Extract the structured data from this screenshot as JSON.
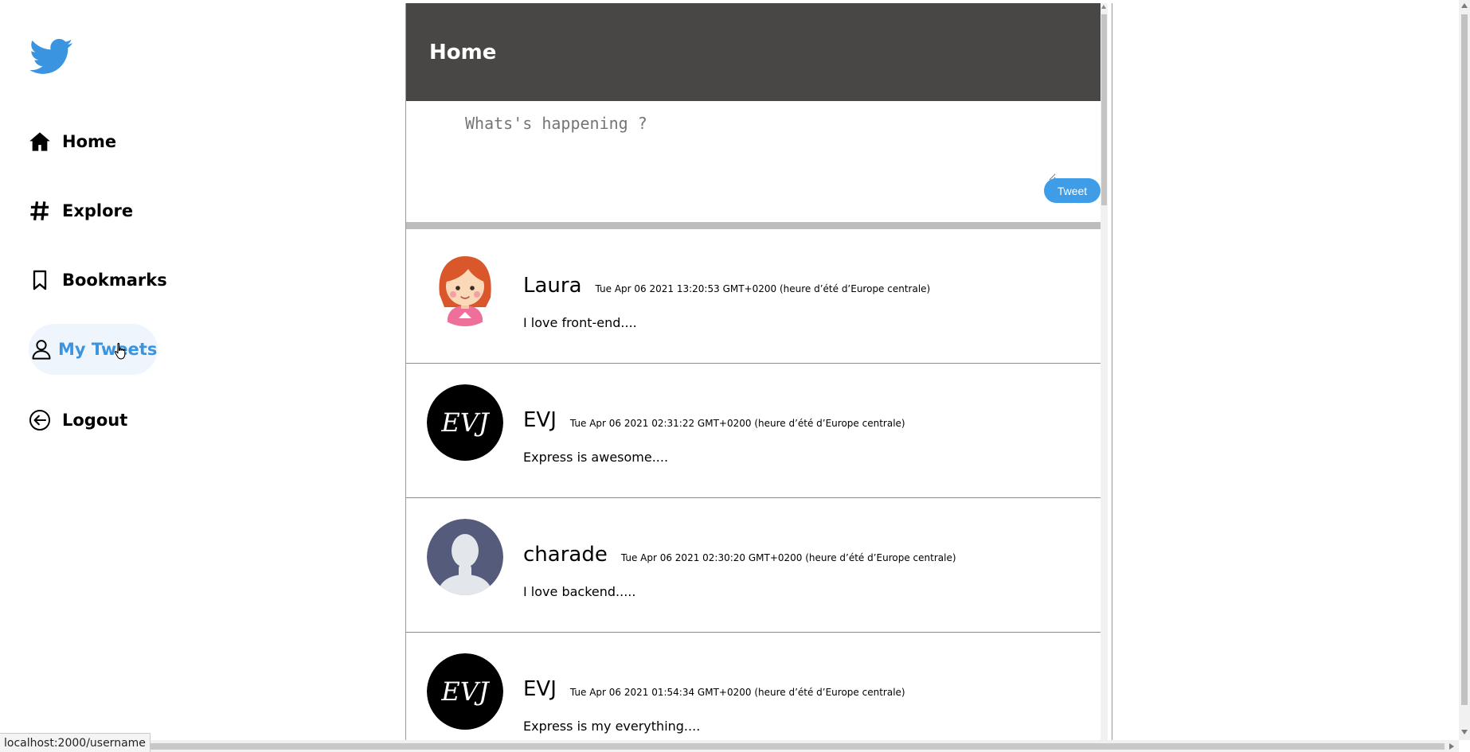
{
  "sidebar": {
    "logo": {
      "icon": "twitter-bird-icon",
      "color": "#3a94e0"
    },
    "items": [
      {
        "label": "Home",
        "icon": "home-icon"
      },
      {
        "label": "Explore",
        "icon": "hashtag-icon"
      },
      {
        "label": "Bookmarks",
        "icon": "bookmark-icon"
      },
      {
        "label": "My Tweets",
        "icon": "user-icon",
        "active": true
      },
      {
        "label": "Logout",
        "icon": "logout-icon"
      }
    ]
  },
  "header": {
    "title": "Home"
  },
  "compose": {
    "placeholder": "Whats's happening ?",
    "tweet_button": "Tweet"
  },
  "tweets": [
    {
      "name": "Laura",
      "date": "Tue Apr 06 2021 13:20:53 GMT+0200 (heure d’été d’Europe centrale)",
      "text": "I love front-end....",
      "avatar": "cartoon-girl-avatar"
    },
    {
      "name": "EVJ",
      "date": "Tue Apr 06 2021 02:31:22 GMT+0200 (heure d’été d’Europe centrale)",
      "text": "Express is awesome....",
      "avatar": "evj-logo-avatar"
    },
    {
      "name": "charade",
      "date": "Tue Apr 06 2021 02:30:20 GMT+0200 (heure d’été d’Europe centrale)",
      "text": "I love backend.....",
      "avatar": "default-person-avatar"
    },
    {
      "name": "EVJ",
      "date": "Tue Apr 06 2021 01:54:34 GMT+0200 (heure d’été d’Europe centrale)",
      "text": "Express is my everything....",
      "avatar": "evj-logo-avatar"
    }
  ],
  "status_bar": {
    "url": "localhost:2000/username"
  },
  "colors": {
    "accent": "#3a94e0",
    "header_bg": "#484746",
    "active_nav_bg": "#eff5fc",
    "tweet_button_bg": "#3f9ce6"
  }
}
